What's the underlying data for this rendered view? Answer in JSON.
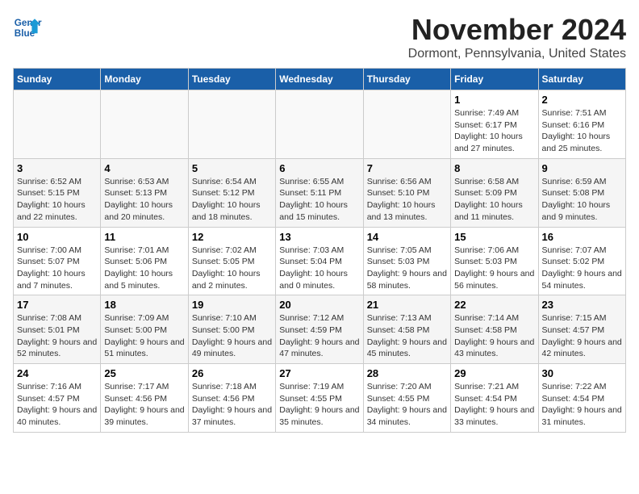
{
  "logo": {
    "line1": "General",
    "line2": "Blue"
  },
  "title": "November 2024",
  "location": "Dormont, Pennsylvania, United States",
  "days_header": [
    "Sunday",
    "Monday",
    "Tuesday",
    "Wednesday",
    "Thursday",
    "Friday",
    "Saturday"
  ],
  "weeks": [
    [
      {
        "day": "",
        "info": ""
      },
      {
        "day": "",
        "info": ""
      },
      {
        "day": "",
        "info": ""
      },
      {
        "day": "",
        "info": ""
      },
      {
        "day": "",
        "info": ""
      },
      {
        "day": "1",
        "info": "Sunrise: 7:49 AM\nSunset: 6:17 PM\nDaylight: 10 hours and 27 minutes."
      },
      {
        "day": "2",
        "info": "Sunrise: 7:51 AM\nSunset: 6:16 PM\nDaylight: 10 hours and 25 minutes."
      }
    ],
    [
      {
        "day": "3",
        "info": "Sunrise: 6:52 AM\nSunset: 5:15 PM\nDaylight: 10 hours and 22 minutes."
      },
      {
        "day": "4",
        "info": "Sunrise: 6:53 AM\nSunset: 5:13 PM\nDaylight: 10 hours and 20 minutes."
      },
      {
        "day": "5",
        "info": "Sunrise: 6:54 AM\nSunset: 5:12 PM\nDaylight: 10 hours and 18 minutes."
      },
      {
        "day": "6",
        "info": "Sunrise: 6:55 AM\nSunset: 5:11 PM\nDaylight: 10 hours and 15 minutes."
      },
      {
        "day": "7",
        "info": "Sunrise: 6:56 AM\nSunset: 5:10 PM\nDaylight: 10 hours and 13 minutes."
      },
      {
        "day": "8",
        "info": "Sunrise: 6:58 AM\nSunset: 5:09 PM\nDaylight: 10 hours and 11 minutes."
      },
      {
        "day": "9",
        "info": "Sunrise: 6:59 AM\nSunset: 5:08 PM\nDaylight: 10 hours and 9 minutes."
      }
    ],
    [
      {
        "day": "10",
        "info": "Sunrise: 7:00 AM\nSunset: 5:07 PM\nDaylight: 10 hours and 7 minutes."
      },
      {
        "day": "11",
        "info": "Sunrise: 7:01 AM\nSunset: 5:06 PM\nDaylight: 10 hours and 5 minutes."
      },
      {
        "day": "12",
        "info": "Sunrise: 7:02 AM\nSunset: 5:05 PM\nDaylight: 10 hours and 2 minutes."
      },
      {
        "day": "13",
        "info": "Sunrise: 7:03 AM\nSunset: 5:04 PM\nDaylight: 10 hours and 0 minutes."
      },
      {
        "day": "14",
        "info": "Sunrise: 7:05 AM\nSunset: 5:03 PM\nDaylight: 9 hours and 58 minutes."
      },
      {
        "day": "15",
        "info": "Sunrise: 7:06 AM\nSunset: 5:03 PM\nDaylight: 9 hours and 56 minutes."
      },
      {
        "day": "16",
        "info": "Sunrise: 7:07 AM\nSunset: 5:02 PM\nDaylight: 9 hours and 54 minutes."
      }
    ],
    [
      {
        "day": "17",
        "info": "Sunrise: 7:08 AM\nSunset: 5:01 PM\nDaylight: 9 hours and 52 minutes."
      },
      {
        "day": "18",
        "info": "Sunrise: 7:09 AM\nSunset: 5:00 PM\nDaylight: 9 hours and 51 minutes."
      },
      {
        "day": "19",
        "info": "Sunrise: 7:10 AM\nSunset: 5:00 PM\nDaylight: 9 hours and 49 minutes."
      },
      {
        "day": "20",
        "info": "Sunrise: 7:12 AM\nSunset: 4:59 PM\nDaylight: 9 hours and 47 minutes."
      },
      {
        "day": "21",
        "info": "Sunrise: 7:13 AM\nSunset: 4:58 PM\nDaylight: 9 hours and 45 minutes."
      },
      {
        "day": "22",
        "info": "Sunrise: 7:14 AM\nSunset: 4:58 PM\nDaylight: 9 hours and 43 minutes."
      },
      {
        "day": "23",
        "info": "Sunrise: 7:15 AM\nSunset: 4:57 PM\nDaylight: 9 hours and 42 minutes."
      }
    ],
    [
      {
        "day": "24",
        "info": "Sunrise: 7:16 AM\nSunset: 4:57 PM\nDaylight: 9 hours and 40 minutes."
      },
      {
        "day": "25",
        "info": "Sunrise: 7:17 AM\nSunset: 4:56 PM\nDaylight: 9 hours and 39 minutes."
      },
      {
        "day": "26",
        "info": "Sunrise: 7:18 AM\nSunset: 4:56 PM\nDaylight: 9 hours and 37 minutes."
      },
      {
        "day": "27",
        "info": "Sunrise: 7:19 AM\nSunset: 4:55 PM\nDaylight: 9 hours and 35 minutes."
      },
      {
        "day": "28",
        "info": "Sunrise: 7:20 AM\nSunset: 4:55 PM\nDaylight: 9 hours and 34 minutes."
      },
      {
        "day": "29",
        "info": "Sunrise: 7:21 AM\nSunset: 4:54 PM\nDaylight: 9 hours and 33 minutes."
      },
      {
        "day": "30",
        "info": "Sunrise: 7:22 AM\nSunset: 4:54 PM\nDaylight: 9 hours and 31 minutes."
      }
    ]
  ]
}
